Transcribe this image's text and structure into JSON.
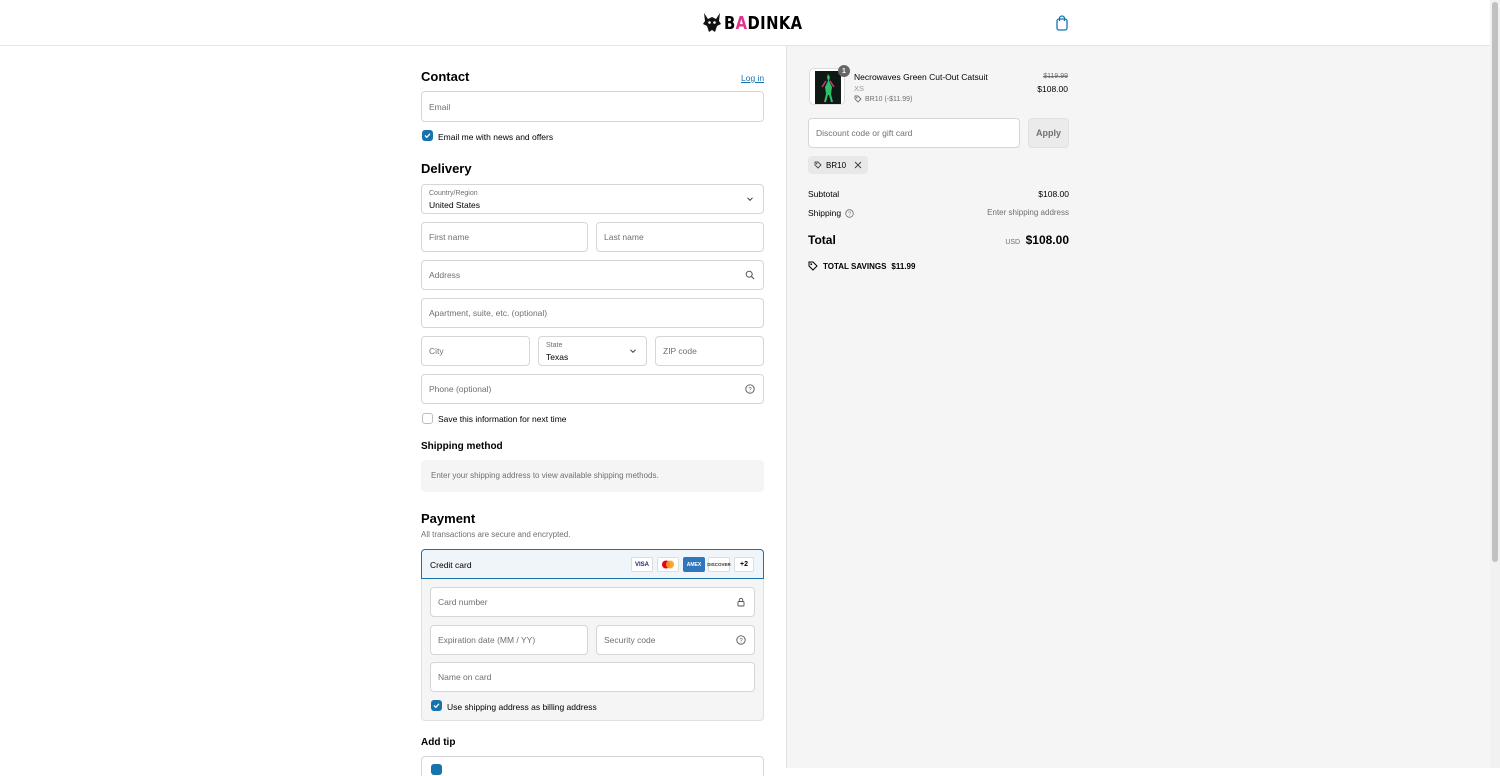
{
  "brand": {
    "name_prefix": "B",
    "name_accent": "A",
    "name_suffix": "DINKA",
    "accent_color": "#e0338a"
  },
  "contact": {
    "title": "Contact",
    "login_link": "Log in",
    "email_placeholder": "Email",
    "news_checkbox_label": "Email me with news and offers",
    "news_checked": true
  },
  "delivery": {
    "title": "Delivery",
    "country_label": "Country/Region",
    "country_value": "United States",
    "first_name_placeholder": "First name",
    "last_name_placeholder": "Last name",
    "address_placeholder": "Address",
    "apartment_placeholder": "Apartment, suite, etc. (optional)",
    "city_placeholder": "City",
    "state_label": "State",
    "state_value": "Texas",
    "zip_placeholder": "ZIP code",
    "phone_placeholder": "Phone (optional)",
    "save_info_label": "Save this information for next time",
    "save_info_checked": false
  },
  "shipping_method": {
    "title": "Shipping method",
    "notice": "Enter your shipping address to view available shipping methods."
  },
  "payment": {
    "title": "Payment",
    "subtitle": "All transactions are secure and encrypted.",
    "method_label": "Credit card",
    "card_brands": [
      "VISA",
      "mastercard",
      "AMEX",
      "DISCOVER"
    ],
    "more_brands": "+2",
    "card_number_placeholder": "Card number",
    "expiry_placeholder": "Expiration date (MM / YY)",
    "security_placeholder": "Security code",
    "name_placeholder": "Name on card",
    "billing_label": "Use shipping address as billing address",
    "billing_checked": true
  },
  "tip": {
    "title": "Add tip"
  },
  "summary": {
    "item": {
      "name": "Necrowaves Green Cut-Out Catsuit",
      "variant": "XS",
      "discount_tag": "BR10 (-$11.99)",
      "quantity": "1",
      "original_price": "$119.99",
      "price": "$108.00"
    },
    "discount_placeholder": "Discount code or gift card",
    "apply_label": "Apply",
    "applied_code": "BR10",
    "subtotal_label": "Subtotal",
    "subtotal_value": "$108.00",
    "shipping_label": "Shipping",
    "shipping_value": "Enter shipping address",
    "total_label": "Total",
    "currency": "USD",
    "total_value": "$108.00",
    "savings_label": "TOTAL SAVINGS",
    "savings_value": "$11.99"
  },
  "colors": {
    "accent": "#1773b0",
    "panel_bg": "#f5f5f5"
  }
}
